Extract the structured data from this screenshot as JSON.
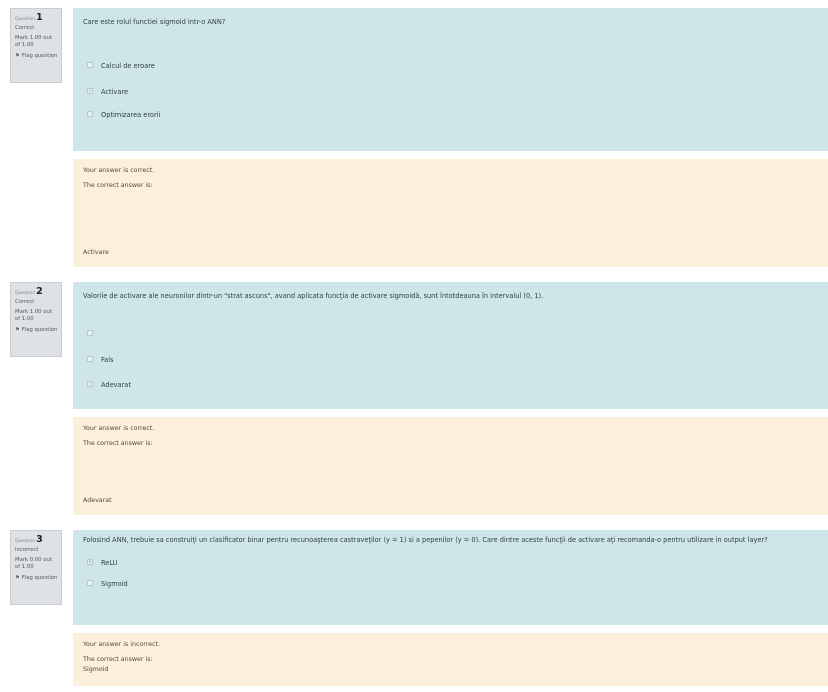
{
  "questions": [
    {
      "question_word": "Question",
      "number": "1",
      "state": "Correct",
      "grade": "Mark 1.00 out of 1.00",
      "flag_label": "Flag question",
      "text": "Care este rolul functiei sigmoid intr-o ANN?",
      "options": [
        {
          "label": "Calcul de eroare",
          "mark": ""
        },
        {
          "label": "Activare",
          "mark": "✓"
        },
        {
          "label": "Optimizarea erorii",
          "mark": ""
        }
      ],
      "feedback": "Your answer is correct.",
      "correct_prefix": "The correct answer is:",
      "correct_value": "Activare"
    },
    {
      "question_word": "Question",
      "number": "2",
      "state": "Correct",
      "grade": "Mark 1.00 out of 1.00",
      "flag_label": "Flag question",
      "text": "Valorile de activare ale neuronilor dintr-un \"strat ascuns\", avand aplicata funcţia de activare sigmoidă, sunt întotdeauna în intervalul (0, 1).",
      "options": [
        {
          "label": "",
          "mark": ""
        },
        {
          "label": "Fals",
          "mark": ""
        },
        {
          "label": "Adevarat",
          "mark": "✓"
        }
      ],
      "feedback": "Your answer is correct.",
      "correct_prefix": "The correct answer is:",
      "correct_value": "Adevarat"
    },
    {
      "question_word": "Question",
      "number": "3",
      "state": "Incorrect",
      "grade": "Mark 0.00 out of 1.00",
      "flag_label": "Flag question",
      "text": "Folosind ANN, trebuie sa construiţi un clasificator binar pentru recunoaşterea castraveţilor (y = 1) si a pepenilor (y = 0). Care dintre aceste funcţii de activare aţi recomanda-o pentru utilizare in output layer?",
      "options": [
        {
          "label": "ReLU",
          "mark": "✕"
        },
        {
          "label": "Sigmoid",
          "mark": ""
        }
      ],
      "feedback": "Your answer is incorrect.",
      "correct_prefix": "The correct answer is:",
      "correct_value": "Sigmoid"
    }
  ]
}
